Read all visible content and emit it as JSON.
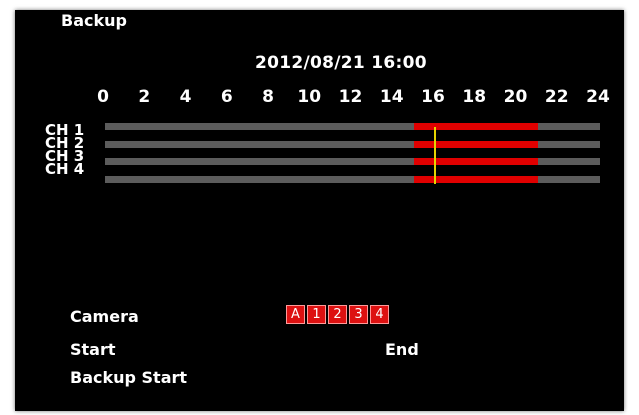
{
  "title": "Backup",
  "timeline": {
    "datetime": "2012/08/21 16:00",
    "hours": [
      "0",
      "2",
      "4",
      "6",
      "8",
      "10",
      "12",
      "14",
      "16",
      "18",
      "20",
      "22",
      "24"
    ],
    "channels": [
      {
        "label": "CH 1",
        "record_start_hour": 15,
        "record_end_hour": 21
      },
      {
        "label": "CH 2",
        "record_start_hour": 15,
        "record_end_hour": 21
      },
      {
        "label": "CH 3",
        "record_start_hour": 15,
        "record_end_hour": 21
      },
      {
        "label": "CH 4",
        "record_start_hour": 15,
        "record_end_hour": 21
      }
    ],
    "cursor_hour": 16,
    "colors": {
      "track": "#5c5c5c",
      "recording": "#e00000",
      "cursor": "#e5d400"
    }
  },
  "form": {
    "camera_label": "Camera",
    "camera_buttons": [
      "A",
      "1",
      "2",
      "3",
      "4"
    ],
    "start_label": "Start",
    "end_label": "End",
    "backup_start_label": "Backup Start"
  }
}
